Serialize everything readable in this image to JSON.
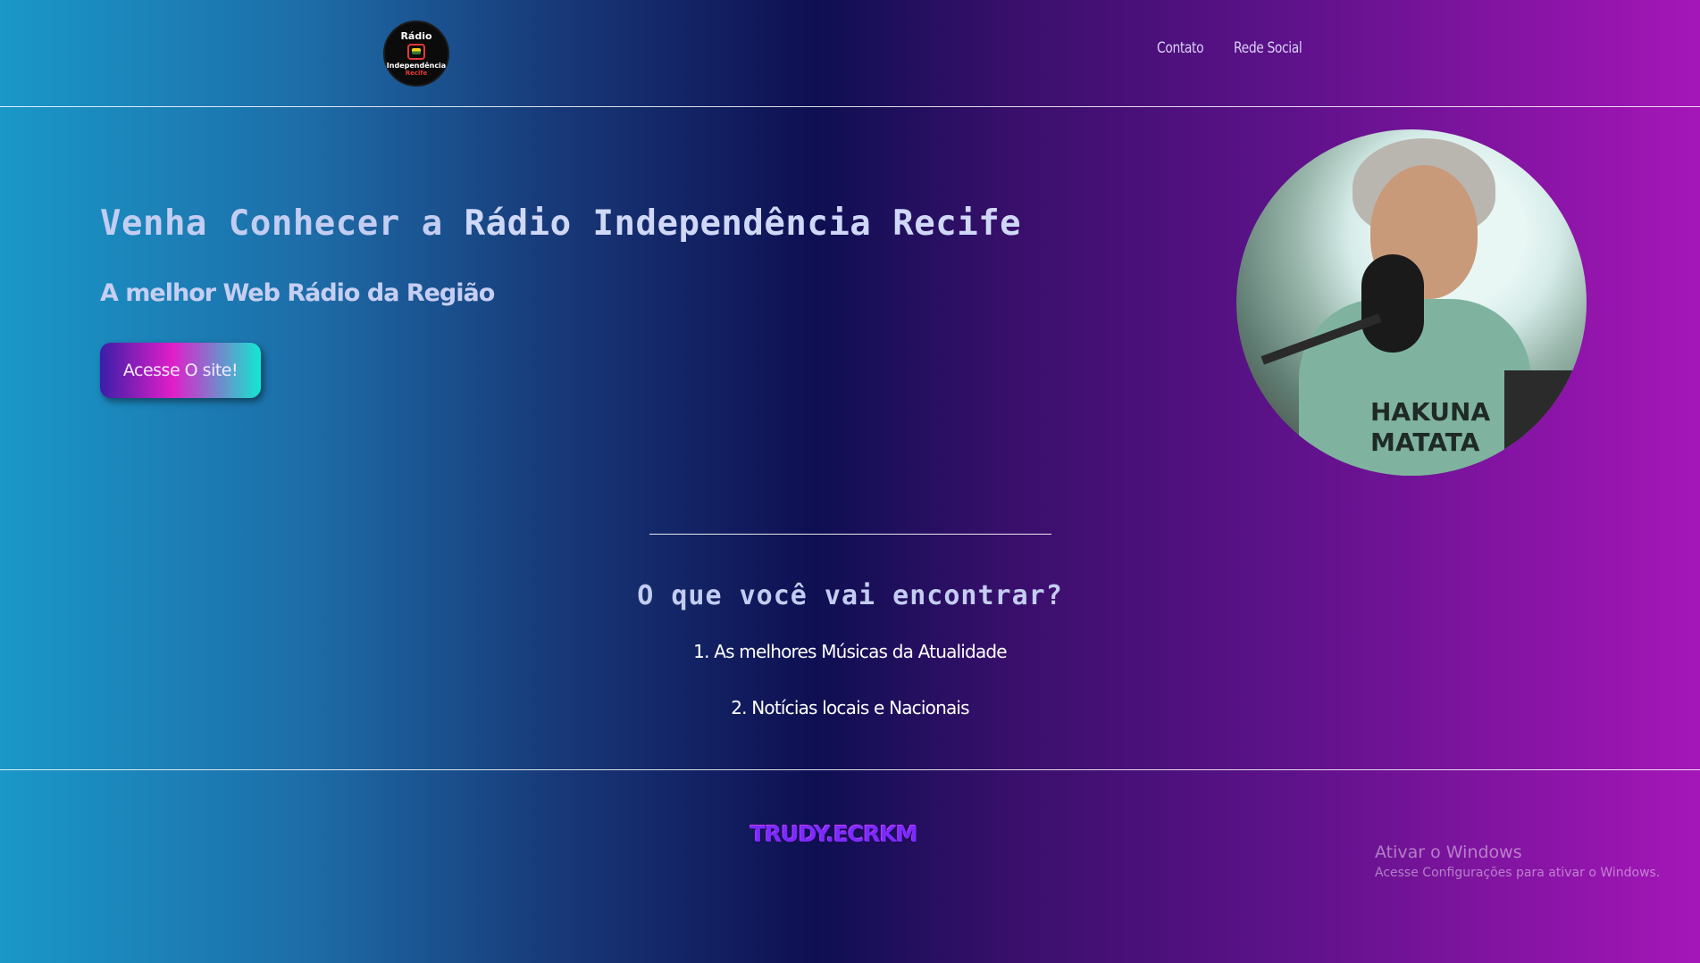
{
  "header": {
    "logo": {
      "line1": "Rádio",
      "line2": "Independência",
      "line3": "Recife"
    },
    "nav": [
      "Contato",
      "Rede Social"
    ]
  },
  "hero": {
    "title_prefix": "Venha Conhecer a ",
    "title_bold": "Rádio Independência Recife",
    "subtitle_prefix": "A melhor ",
    "subtitle_bold": "Web Rádio da Região",
    "cta_label": "Acesse O site!",
    "photo_shirt_text": [
      "HAKUNA",
      "MATATA"
    ]
  },
  "section": {
    "title": "O que você vai encontrar?",
    "items": [
      "1. As melhores Músicas da Atualidade",
      "2. Notícias locais e Nacionais"
    ]
  },
  "footer": {
    "logo_text": "TRUDY.ECRKM"
  },
  "os_watermark": {
    "line1": "Ativar o Windows",
    "line2": "Acesse Configurações para ativar o Windows."
  },
  "colors": {
    "accent_pink": "#e01ec9",
    "accent_cyan": "#12e8d0",
    "accent_purple": "#3a1ea8"
  }
}
